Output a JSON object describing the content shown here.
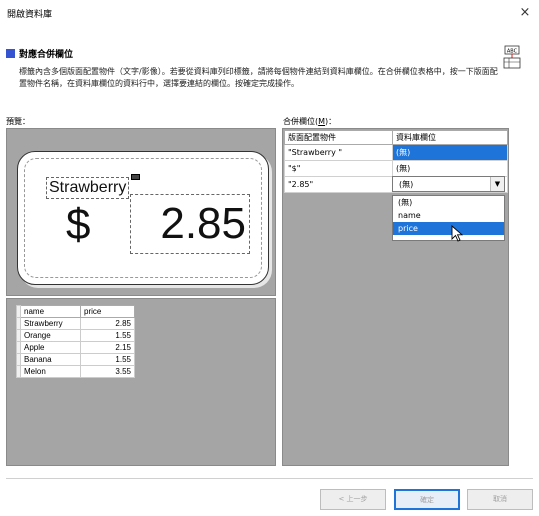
{
  "window": {
    "title": "開啟資料庫",
    "close_glyph": "×"
  },
  "section": {
    "title": "對應合併欄位",
    "description": "標籤內含多個版面配置物件（文字/影像）。若要從資料庫列印標籤，請將每個物件連結到資料庫欄位。在合併欄位表格中，按一下版面配置物件名稱，在資料庫欄位的資料行中，選擇要連結的欄位。按確定完成操作。"
  },
  "preview": {
    "label": "預覽：",
    "name_text": "Strawberry",
    "dollar_text": "$",
    "price_text": "2.85"
  },
  "database": {
    "columns": [
      "name",
      "price"
    ],
    "rows": [
      [
        "Strawberry",
        "2.85"
      ],
      [
        "Orange",
        "1.55"
      ],
      [
        "Apple",
        "2.15"
      ],
      [
        "Banana",
        "1.55"
      ],
      [
        "Melon",
        "3.55"
      ]
    ]
  },
  "merge_fields": {
    "label_prefix": "合併欄位(",
    "label_key": "M",
    "label_suffix": ")：",
    "headers": [
      "版面配置物件",
      "資料庫欄位"
    ],
    "rows": [
      [
        "\"Strawberry \"",
        "(無)"
      ],
      [
        "\"$\"",
        "(無)"
      ],
      [
        "\"2.85\"",
        ""
      ]
    ],
    "combo_value": "(無)",
    "dropdown_options": [
      "(無)",
      "name",
      "price"
    ],
    "highlighted_option": "price"
  },
  "buttons": {
    "back": "< 上一步",
    "ok": "確定",
    "cancel": "取消"
  },
  "colors": {
    "accent": "#1e74d8",
    "section_icon": "#3454d1",
    "pane_bg": "#a5a5a5"
  }
}
